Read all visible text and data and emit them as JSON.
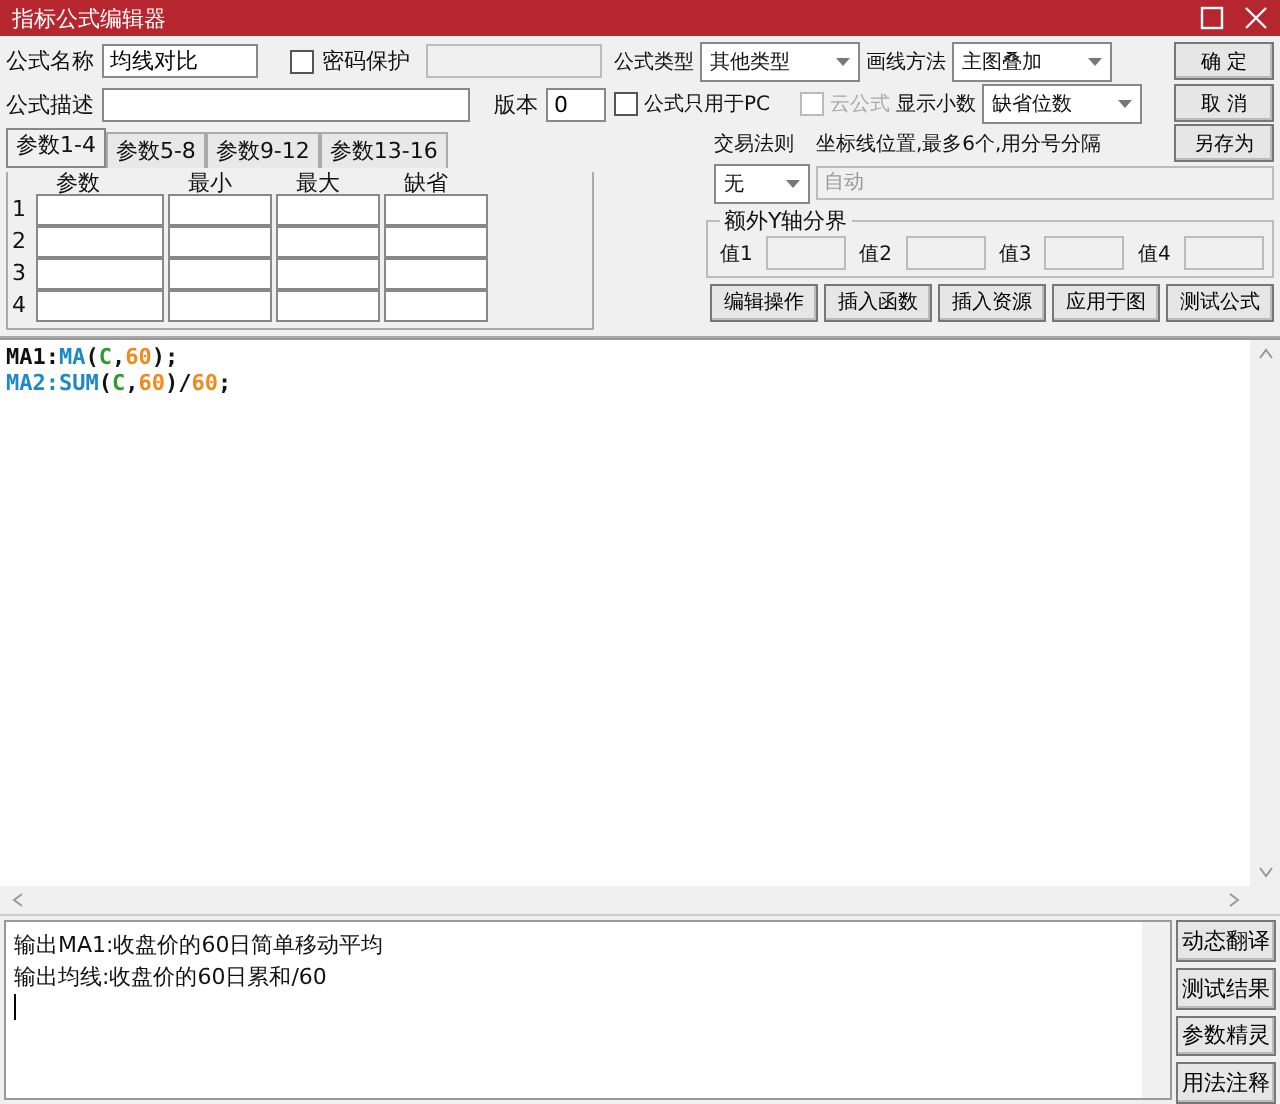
{
  "window": {
    "title": "指标公式编辑器"
  },
  "formula_name": {
    "label": "公式名称",
    "value": "均线对比"
  },
  "password": {
    "label": "密码保护",
    "checked": false
  },
  "description": {
    "label": "公式描述"
  },
  "version": {
    "label": "版本",
    "value": "0"
  },
  "param_tabs": [
    {
      "label": "参数1-4",
      "selected": true
    },
    {
      "label": "参数5-8",
      "selected": false
    },
    {
      "label": "参数9-12",
      "selected": false
    },
    {
      "label": "参数13-16",
      "selected": false
    }
  ],
  "param_table": {
    "columns": [
      "参数",
      "最小",
      "最大",
      "缺省"
    ],
    "rows": [
      "1",
      "2",
      "3",
      "4"
    ]
  },
  "formula_type": {
    "label": "公式类型",
    "value": "其他类型"
  },
  "draw_method": {
    "label": "画线方法",
    "value": "主图叠加"
  },
  "pc_only": {
    "label": "公式只用于PC",
    "checked": false
  },
  "cloud": {
    "label": "云公式",
    "checked": false,
    "disabled": true
  },
  "decimals": {
    "label": "显示小数",
    "value": "缺省位数"
  },
  "actions": [
    "确 定",
    "取 消",
    "另存为"
  ],
  "trade_rule": {
    "label": "交易法则",
    "value": "无"
  },
  "axis_lines": {
    "label": "坐标线位置,最多6个,用分号分隔",
    "placeholder": "自动"
  },
  "y_bounds": {
    "title": "额外Y轴分界",
    "fields": [
      "值1",
      "值2",
      "值3",
      "值4"
    ]
  },
  "tools": [
    "编辑操作",
    "插入函数",
    "插入资源",
    "应用于图",
    "测试公式"
  ],
  "code": [
    [
      {
        "kind": "plain",
        "text": "MA1:"
      },
      {
        "kind": "func",
        "text": "MA"
      },
      {
        "kind": "plain",
        "text": "("
      },
      {
        "kind": "var",
        "text": "C"
      },
      {
        "kind": "plain",
        "text": ","
      },
      {
        "kind": "num",
        "text": "60"
      },
      {
        "kind": "plain",
        "text": ");"
      }
    ],
    [
      {
        "kind": "func",
        "text": "MA2:SUM"
      },
      {
        "kind": "plain",
        "text": "("
      },
      {
        "kind": "var",
        "text": "C"
      },
      {
        "kind": "plain",
        "text": ","
      },
      {
        "kind": "num",
        "text": "60"
      },
      {
        "kind": "plain",
        "text": ")/"
      },
      {
        "kind": "num",
        "text": "60"
      },
      {
        "kind": "plain",
        "text": ";"
      }
    ]
  ],
  "output": [
    "输出MA1:收盘价的60日简单移动平均",
    "输出均线:收盘价的60日累和/60"
  ],
  "side_buttons": [
    "动态翻译",
    "测试结果",
    "参数精灵",
    "用法注释"
  ]
}
